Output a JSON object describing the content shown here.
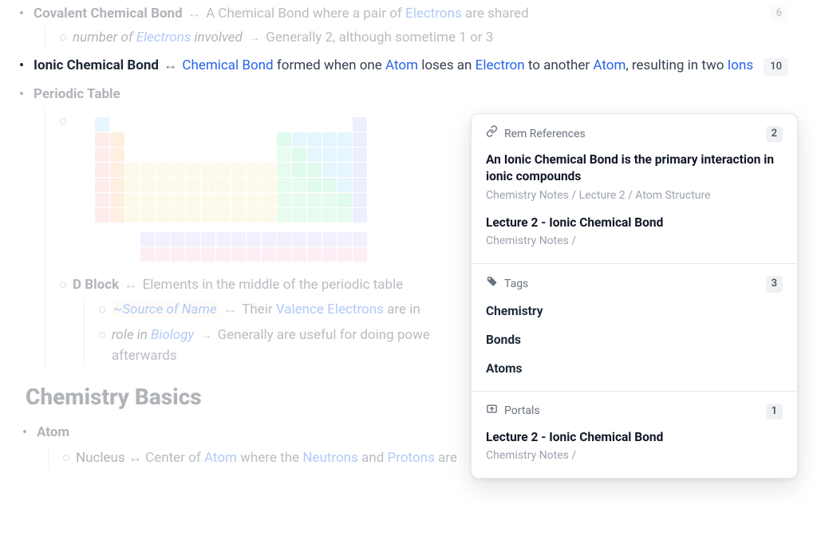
{
  "notes": {
    "covalent": {
      "title": "Covalent Chemical Bond",
      "def_pre": "A Chemical Bond where a pair of ",
      "def_link": "Electrons",
      "def_post": " are shared",
      "count": "6",
      "child": {
        "label_pre": "number of ",
        "label_link": "Electrons",
        "label_post": " involved",
        "value": "Generally 2, although sometime 1 or 3"
      }
    },
    "ionic": {
      "title": "Ionic Chemical Bond",
      "link1": "Chemical Bond",
      "seg1": " formed when one ",
      "link2": "Atom",
      "seg2": " loses an ",
      "link3": "Electron",
      "seg3": " to another ",
      "link4": "Atom",
      "seg4": ", resulting in two ",
      "link5": "Ions",
      "count": "10"
    },
    "periodic": {
      "title": "Periodic Table",
      "dblock": {
        "title": "D Block",
        "def": "Elements in the middle of the periodic table",
        "src_label": "~Source of Name",
        "src_seg1": "Their ",
        "src_link": "Valence Electrons",
        "src_seg2": " are in",
        "role_pre": "role in ",
        "role_link": "Biology",
        "role_val": "Generally are useful for doing powe",
        "role_val2": "afterwards"
      }
    },
    "basics": {
      "heading": "Chemistry Basics",
      "atom": "Atom",
      "nucleus_pre": "Nucleus",
      "nucleus_txt": " ↔ Center of ",
      "nucleus_link1": "Atom",
      "nucleus_mid": " where the ",
      "nucleus_link2": "Neutrons",
      "nucleus_and": " and ",
      "nucleus_link3": "Protons",
      "nucleus_post": " are"
    }
  },
  "panel": {
    "refs": {
      "label": "Rem References",
      "count": "2",
      "items": [
        {
          "title": "An Ionic Chemical Bond is the primary interaction in ionic compounds",
          "path": "Chemistry Notes / Lecture 2 / Atom Structure"
        },
        {
          "title": "Lecture 2 - Ionic Chemical Bond",
          "path": "Chemistry Notes /"
        }
      ]
    },
    "tags": {
      "label": "Tags",
      "count": "3",
      "items": [
        "Chemistry",
        "Bonds",
        "Atoms"
      ]
    },
    "portals": {
      "label": "Portals",
      "count": "1",
      "items": [
        {
          "title": "Lecture 2 -  Ionic Chemical Bond",
          "path": "Chemistry Notes /"
        }
      ]
    }
  }
}
